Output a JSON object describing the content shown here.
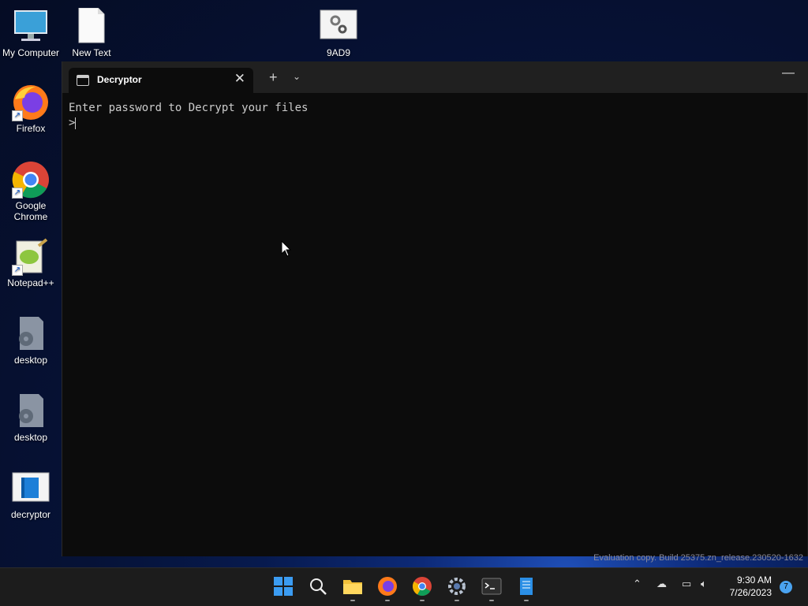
{
  "desktop": {
    "icons": [
      {
        "label": "My Computer"
      },
      {
        "label": "New Text"
      },
      {
        "label": "9AD9"
      },
      {
        "label": "Firefox"
      },
      {
        "label": "Google Chrome"
      },
      {
        "label": "Notepad++"
      },
      {
        "label": "desktop"
      },
      {
        "label": "desktop"
      },
      {
        "label": "decryptor"
      }
    ]
  },
  "terminal": {
    "tab_title": "Decryptor",
    "close_glyph": "✕",
    "new_tab_glyph": "+",
    "dropdown_glyph": "⌄",
    "minimize_glyph": "—",
    "line1": "Enter password to Decrypt your files",
    "prompt": ">"
  },
  "watermark": "Evaluation copy. Build 25375.zn_release.230520-1632",
  "taskbar": {
    "apps": [
      "start-icon",
      "search-icon",
      "file-explorer-icon",
      "firefox-icon",
      "chrome-icon",
      "settings-icon",
      "terminal-icon",
      "notepad-icon"
    ],
    "time": "9:30 AM",
    "date": "7/26/2023",
    "notifications": "7"
  },
  "colors": {
    "terminal_bg": "#0c0c0c",
    "titlebar_bg": "#202020",
    "taskbar_bg": "#1c1c1c",
    "text": "#cccccc"
  }
}
